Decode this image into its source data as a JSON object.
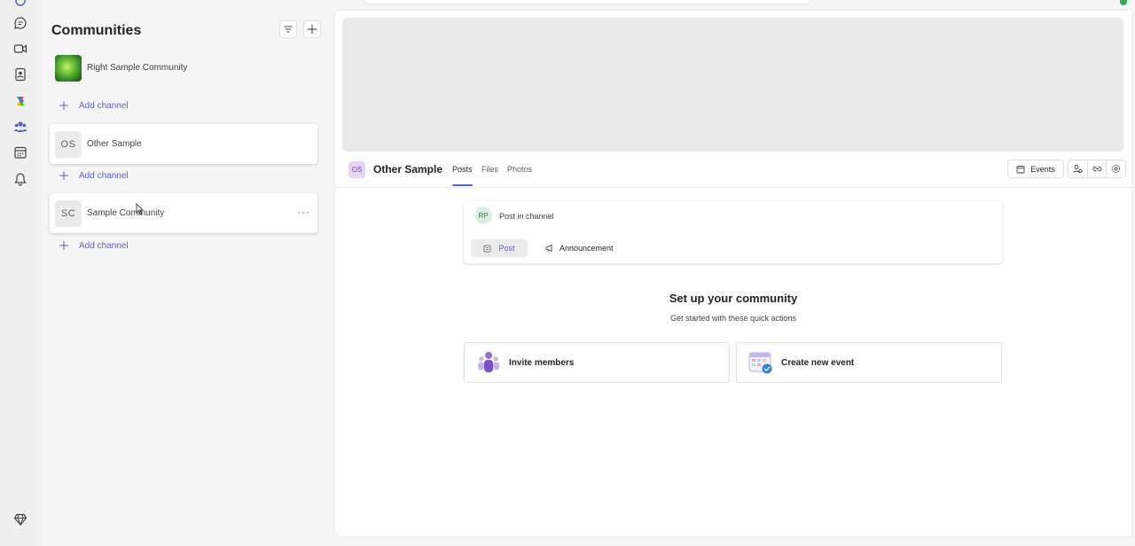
{
  "rail": {
    "icons": [
      "chat-icon",
      "meet-icon",
      "contacts-icon",
      "copilot-icon",
      "communities-icon",
      "calendar-icon",
      "activity-icon",
      "premium-icon"
    ]
  },
  "sidebar": {
    "title": "Communities",
    "communities": [
      {
        "name": "Right Sample Community",
        "initials": ""
      },
      {
        "name": "Other Sample",
        "initials": "OS"
      },
      {
        "name": "Sample Community",
        "initials": "SC",
        "more": "···"
      }
    ],
    "add_channel_label": "Add channel"
  },
  "main": {
    "channel": {
      "initials": "OS",
      "title": "Other Sample",
      "tabs": [
        "Posts",
        "Files",
        "Photos"
      ],
      "active_tab": "Posts"
    },
    "events_label": "Events",
    "composer": {
      "avatar_initials": "RP",
      "placeholder": "Post in channel",
      "post_label": "Post",
      "announcement_label": "Announcement"
    },
    "setup": {
      "title": "Set up your community",
      "subtitle": "Get started with these quick actions",
      "actions": [
        {
          "label": "Invite members",
          "icon": "invite-members-icon"
        },
        {
          "label": "Create new event",
          "icon": "create-event-icon"
        }
      ]
    }
  },
  "colors": {
    "accent": "#5b5fc7",
    "rail_bg": "#f0f0f0",
    "panel_bg": "#f5f5f5"
  }
}
